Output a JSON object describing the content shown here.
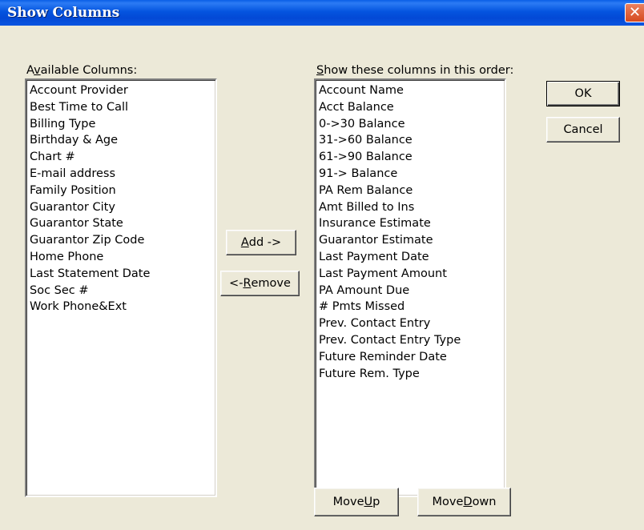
{
  "window": {
    "title": "Show Columns",
    "close_glyph": "✕"
  },
  "available": {
    "label_prefix": "A",
    "label_accel": "v",
    "label_rest": "ailable Columns:",
    "items": [
      "Account Provider",
      "Best Time to Call",
      "Billing Type",
      "Birthday & Age",
      "Chart #",
      "E-mail address",
      "Family Position",
      "Guarantor City",
      "Guarantor State",
      "Guarantor Zip Code",
      "Home Phone",
      "Last Statement Date",
      "Soc Sec #",
      "Work Phone&Ext"
    ]
  },
  "shown": {
    "label_accel": "S",
    "label_rest": "how these columns in this order:",
    "items": [
      "Account Name",
      "Acct Balance",
      "0->30 Balance",
      "31->60 Balance",
      "61->90 Balance",
      "91-> Balance",
      "PA Rem Balance",
      "Amt Billed to Ins",
      "Insurance Estimate",
      "Guarantor Estimate",
      "Last Payment Date",
      "Last Payment Amount",
      "PA Amount Due",
      "# Pmts Missed",
      "Prev. Contact Entry",
      "Prev. Contact Entry Type",
      "Future Reminder Date",
      "Future Rem. Type"
    ]
  },
  "buttons": {
    "ok": "OK",
    "cancel": "Cancel",
    "add_accel": "A",
    "add_rest": "dd ->",
    "remove_prefix": "<- ",
    "remove_accel": "R",
    "remove_rest": "emove",
    "moveup_prefix": "Move ",
    "moveup_accel": "U",
    "moveup_rest": "p",
    "movedown_prefix": "Move ",
    "movedown_accel": "D",
    "movedown_rest": "own"
  }
}
